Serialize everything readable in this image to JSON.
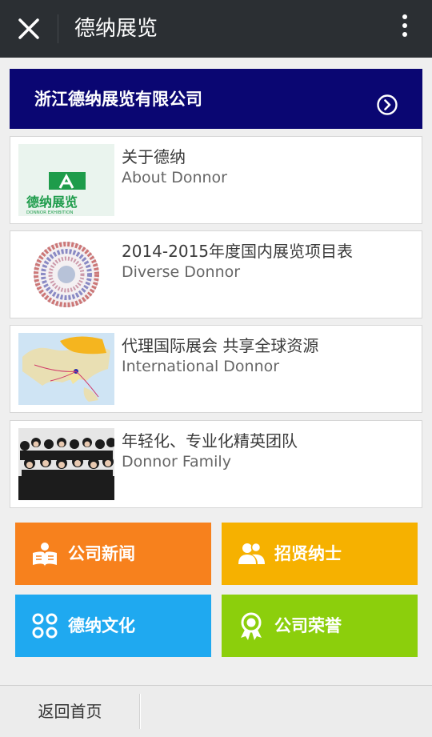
{
  "header": {
    "title": "德纳展览"
  },
  "banner": {
    "title": "浙江德纳展览有限公司"
  },
  "cards": [
    {
      "zh": "关于德纳",
      "en": "About Donnor",
      "thumb_text": "德纳展览",
      "thumb_sub": "DONNOR EXHIBITION"
    },
    {
      "zh": "2014-2015年度国内展览项目表",
      "en": "Diverse Donnor"
    },
    {
      "zh": "代理国际展会 共享全球资源",
      "en": "International Donnor"
    },
    {
      "zh": "年轻化、专业化精英团队",
      "en": "Donnor Family"
    }
  ],
  "tiles": [
    {
      "label": "公司新闻",
      "color": "#f7811d",
      "icon": "news-reader-icon"
    },
    {
      "label": "招贤纳士",
      "color": "#f6b100",
      "icon": "people-icon"
    },
    {
      "label": "德纳文化",
      "color": "#1fa9f0",
      "icon": "grid-icon"
    },
    {
      "label": "公司荣誉",
      "color": "#8ccf0c",
      "icon": "award-icon"
    }
  ],
  "footer": {
    "home_label": "返回首页"
  }
}
